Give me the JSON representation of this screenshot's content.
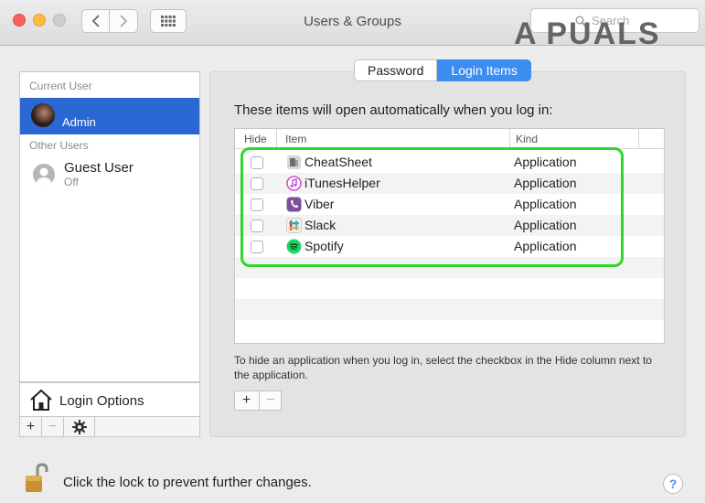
{
  "window": {
    "title": "Users & Groups",
    "search_placeholder": "Search",
    "watermark": "A PUALS"
  },
  "sidebar": {
    "current_user_label": "Current User",
    "current_user": {
      "name": "Admin"
    },
    "other_users_label": "Other Users",
    "other_users": [
      {
        "name": "Guest User",
        "status": "Off"
      }
    ],
    "login_options_label": "Login Options",
    "buttons": {
      "add": "+",
      "remove": "−",
      "action": "gear-icon"
    }
  },
  "tabs": [
    {
      "label": "Password",
      "active": false
    },
    {
      "label": "Login Items",
      "active": true
    }
  ],
  "login_items": {
    "heading": "These items will open automatically when you log in:",
    "columns": [
      "Hide",
      "Item",
      "Kind"
    ],
    "rows": [
      {
        "name": "CheatSheet",
        "kind": "Application",
        "hide": false,
        "icon": "cheatsheet-icon"
      },
      {
        "name": "iTunesHelper",
        "kind": "Application",
        "hide": false,
        "icon": "itunes-icon"
      },
      {
        "name": "Viber",
        "kind": "Application",
        "hide": false,
        "icon": "viber-icon"
      },
      {
        "name": "Slack",
        "kind": "Application",
        "hide": false,
        "icon": "slack-icon"
      },
      {
        "name": "Spotify",
        "kind": "Application",
        "hide": false,
        "icon": "spotify-icon"
      }
    ],
    "hint": "To hide an application when you log in, select the checkbox in the Hide column next to the application.",
    "add_label": "+",
    "remove_label": "−"
  },
  "footer": {
    "lock_text": "Click the lock to prevent further changes.",
    "help_label": "?"
  },
  "colors": {
    "accent": "#3c8df0",
    "selection": "#2a67d3",
    "highlight_box": "#2ed82a"
  }
}
